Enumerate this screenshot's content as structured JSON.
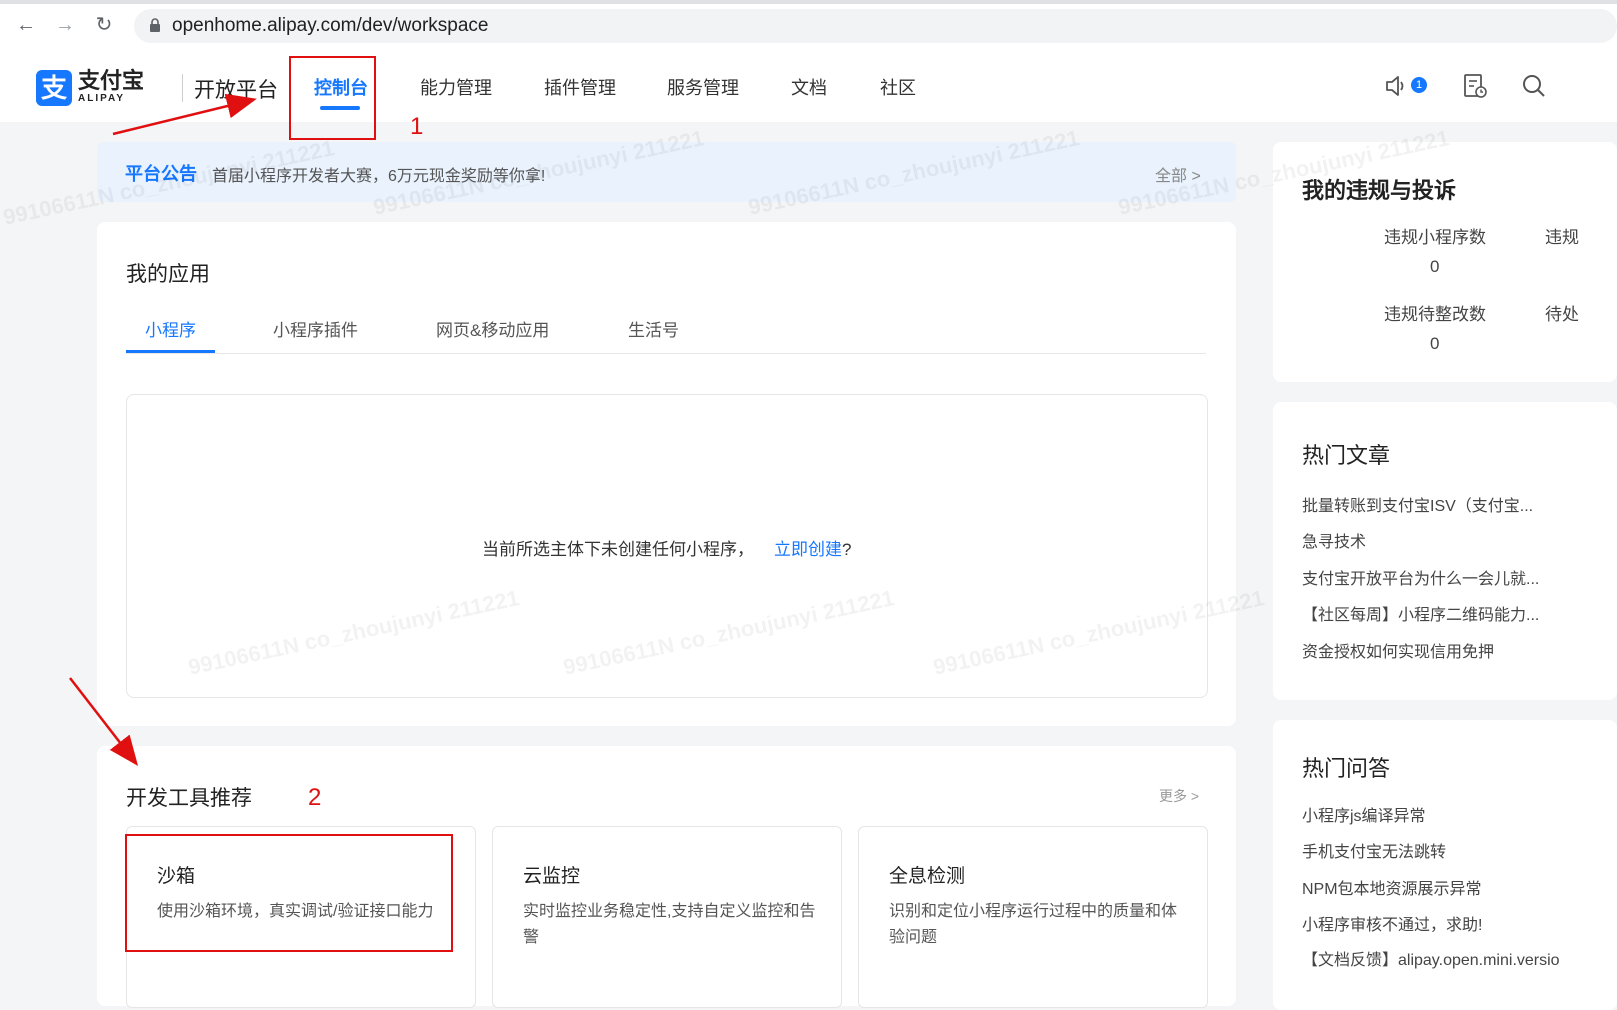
{
  "browser": {
    "url": "openhome.alipay.com/dev/workspace"
  },
  "header": {
    "logo_mark": "支",
    "logo_text": "支付宝",
    "logo_sub": "ALIPAY",
    "platform": "开放平台",
    "nav": [
      {
        "label": "控制台",
        "active": true
      },
      {
        "label": "能力管理"
      },
      {
        "label": "插件管理"
      },
      {
        "label": "服务管理"
      },
      {
        "label": "文档"
      },
      {
        "label": "社区"
      }
    ],
    "notification_count": "1"
  },
  "notice": {
    "title": "平台公告",
    "text": "首届小程序开发者大赛，6万元现金奖励等你拿!",
    "more": "全部 >"
  },
  "my_apps": {
    "title": "我的应用",
    "tabs": [
      "小程序",
      "小程序插件",
      "网页&移动应用",
      "生活号"
    ],
    "empty_text": "当前所选主体下未创建任何小程序，",
    "empty_link": "立即创建",
    "empty_suffix": "?"
  },
  "dev_tools": {
    "title": "开发工具推荐",
    "more": "更多 >",
    "tools": [
      {
        "name": "沙箱",
        "desc": "使用沙箱环境，真实调试/验证接口能力"
      },
      {
        "name": "云监控",
        "desc": "实时监控业务稳定性,支持自定义监控和告警"
      },
      {
        "name": "全息检测",
        "desc": "识别和定位小程序运行过程中的质量和体验问题"
      }
    ]
  },
  "violations": {
    "title": "我的违规与投诉",
    "stats": [
      {
        "label": "违规小程序数",
        "value": "0"
      },
      {
        "label": "违规",
        "value": ""
      },
      {
        "label": "违规待整改数",
        "value": "0"
      },
      {
        "label": "待处",
        "value": ""
      }
    ]
  },
  "hot_articles": {
    "title": "热门文章",
    "items": [
      "批量转账到支付宝ISV（支付宝...",
      "急寻技术",
      "支付宝开放平台为什么一会儿就...",
      "【社区每周】小程序二维码能力...",
      "资金授权如何实现信用免押"
    ]
  },
  "hot_qa": {
    "title": "热门问答",
    "items": [
      "小程序js编译异常",
      "手机支付宝无法跳转",
      "NPM包本地资源展示异常",
      "小程序审核不通过，求助!",
      "【文档反馈】alipay.open.mini.versio"
    ]
  },
  "annotations": {
    "num1": "1",
    "num2": "2",
    "color": "#e01010"
  },
  "watermark": "99106611N co_zhoujunyi 211221"
}
